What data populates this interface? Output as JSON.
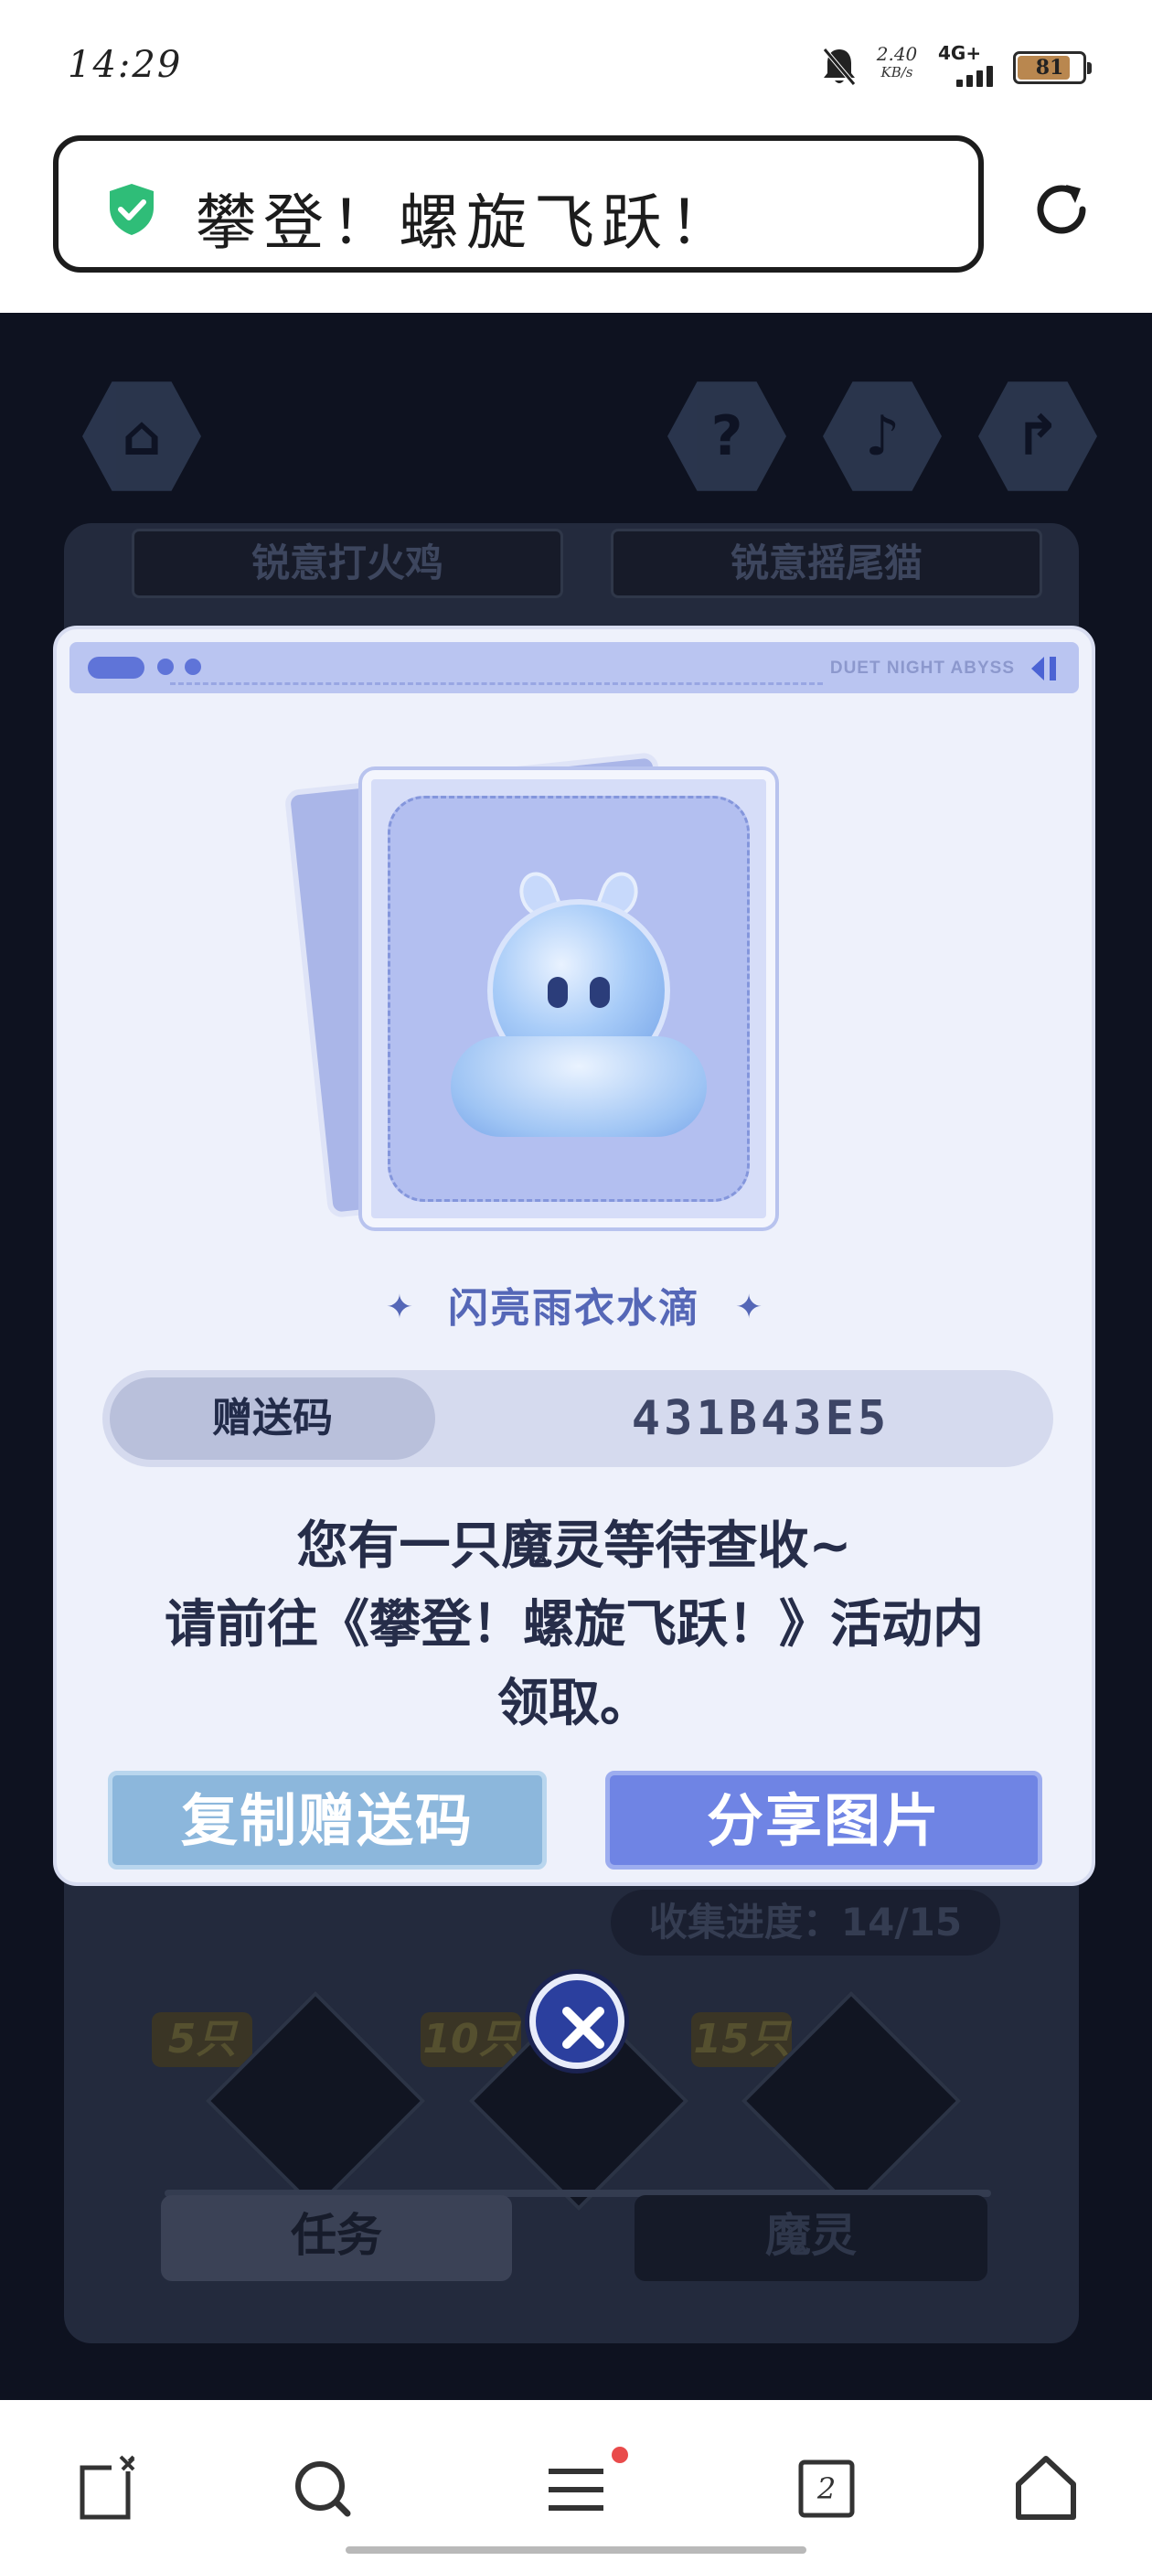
{
  "status_bar": {
    "time": "14:29",
    "net_speed_value": "2.40",
    "net_speed_unit": "KB/s",
    "network_type": "4G+",
    "battery_level": "81",
    "battery_fraction": 0.81,
    "icons": [
      "bell-muted-icon",
      "signal-icon",
      "battery-icon"
    ]
  },
  "browser": {
    "page_title": "攀登！螺旋飞跃！",
    "secure_icon": "shield-check-icon",
    "reload_icon": "reload-icon"
  },
  "game_background": {
    "top_buttons": [
      "home-icon",
      "help-icon",
      "music-icon",
      "share-icon"
    ],
    "tab_left": "锐意打火鸡",
    "tab_right": "锐意摇尾猫",
    "progress_label": "收集进度：",
    "progress_value": "14/15",
    "tiers": [
      "5只",
      "10只",
      "15只"
    ],
    "bottom_left": "任务",
    "bottom_right": "魔灵"
  },
  "popup": {
    "header_brand": "DUET NIGHT ABYSS",
    "item_name": "闪亮雨衣水滴",
    "code_label": "赠送码",
    "code_value": "431B43E5",
    "message_line1": "您有一只魔灵等待查收~",
    "message_line2": "请前往《攀登！螺旋飞跃！》活动内",
    "message_line3": "领取。",
    "copy_button": "复制赠送码",
    "share_button": "分享图片",
    "close_icon": "close-icon"
  },
  "bottom_nav": {
    "items": [
      "close-tab-icon",
      "search-icon",
      "menu-icon",
      "tabs-icon",
      "home-icon"
    ],
    "tabs_count": "2",
    "colors": {
      "accent": "#e94b4b"
    }
  }
}
